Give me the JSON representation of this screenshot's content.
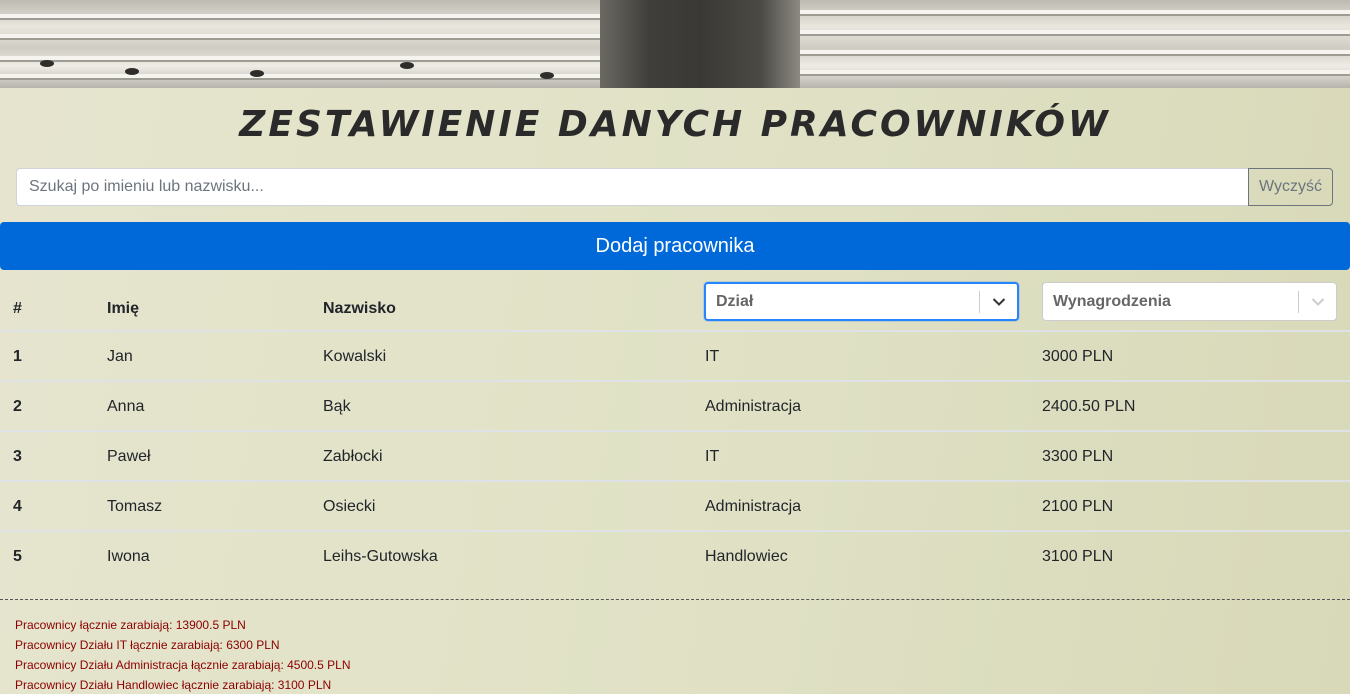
{
  "page": {
    "title": "ZESTAWIENIE DANYCH PRACOWNIKÓW"
  },
  "search": {
    "placeholder": "Szukaj po imieniu lub nazwisku...",
    "value": "",
    "clear_label": "Wyczyść"
  },
  "add_button": {
    "label": "Dodaj pracownika"
  },
  "table": {
    "headers": {
      "num": "#",
      "first_name": "Imię",
      "last_name": "Nazwisko"
    },
    "filters": {
      "department": "Dział",
      "salary": "Wynagrodzenia"
    },
    "rows": [
      {
        "num": "1",
        "first_name": "Jan",
        "last_name": "Kowalski",
        "department": "IT",
        "salary": "3000 PLN"
      },
      {
        "num": "2",
        "first_name": "Anna",
        "last_name": "Bąk",
        "department": "Administracja",
        "salary": "2400.50 PLN"
      },
      {
        "num": "3",
        "first_name": "Paweł",
        "last_name": "Zabłocki",
        "department": "IT",
        "salary": "3300 PLN"
      },
      {
        "num": "4",
        "first_name": "Tomasz",
        "last_name": "Osiecki",
        "department": "Administracja",
        "salary": "2100 PLN"
      },
      {
        "num": "5",
        "first_name": "Iwona",
        "last_name": "Leihs-Gutowska",
        "department": "Handlowiec",
        "salary": "3100 PLN"
      }
    ]
  },
  "summary": [
    "Pracownicy łącznie zarabiają: 13900.5 PLN",
    "Pracownicy Działu IT łącznie zarabiają: 6300 PLN",
    "Pracownicy Działu Administracja łącznie zarabiają: 4500.5 PLN",
    "Pracownicy Działu Handlowiec łącznie zarabiają: 3100 PLN"
  ],
  "colors": {
    "primary": "#0069d9",
    "focus": "#2684ff",
    "summary_text": "#8b0000"
  },
  "icons": {
    "select_chevron": "chevron-down-icon"
  }
}
